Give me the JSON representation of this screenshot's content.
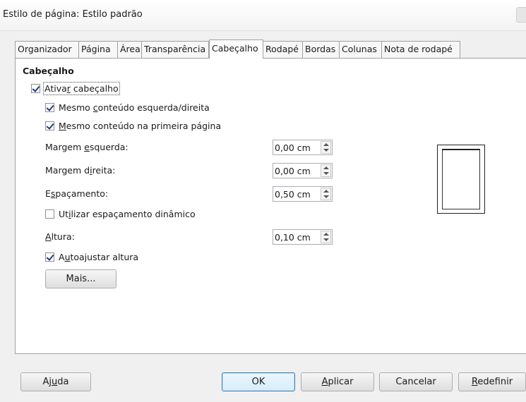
{
  "window": {
    "title": "Estilo de página: Estilo padrão"
  },
  "tabs": [
    {
      "label": "Organizador",
      "active": false
    },
    {
      "label": "Página",
      "active": false
    },
    {
      "label": "Área",
      "active": false
    },
    {
      "label": "Transparência",
      "active": false
    },
    {
      "label": "Cabeçalho",
      "active": true
    },
    {
      "label": "Rodapé",
      "active": false
    },
    {
      "label": "Bordas",
      "active": false
    },
    {
      "label": "Colunas",
      "active": false
    },
    {
      "label": "Nota de rodapé",
      "active": false
    }
  ],
  "header": {
    "section_title": "Cabeçalho",
    "enable": {
      "pre": "Ativa",
      "u": "r",
      "post": " cabeçalho",
      "checked": true
    },
    "same_lr": {
      "pre": "Mesmo ",
      "u": "c",
      "post": "onteúdo esquerda/direita",
      "checked": true
    },
    "same_first": {
      "pre": "",
      "u": "M",
      "post": "esmo conteúdo na primeira página",
      "checked": true
    },
    "margin_left": {
      "pre": "Margem ",
      "u": "e",
      "post": "squerda:",
      "value": "0,00 cm"
    },
    "margin_right": {
      "pre": "Margem d",
      "u": "i",
      "post": "reita:",
      "value": "0,00 cm"
    },
    "spacing": {
      "pre": "E",
      "u": "s",
      "post": "paçamento:",
      "value": "0,50 cm"
    },
    "dynamic_spacing": {
      "pre": "Ut",
      "u": "i",
      "post": "lizar espaçamento dinâmico",
      "checked": false
    },
    "height": {
      "pre": "",
      "u": "A",
      "post": "ltura:",
      "value": "0,10 cm"
    },
    "autofit": {
      "pre": "A",
      "u": "u",
      "post": "toajustar altura",
      "checked": true
    },
    "more_button": "Mais..."
  },
  "buttons": {
    "help": {
      "pre": "Aj",
      "u": "u",
      "post": "da"
    },
    "ok": "OK",
    "apply": {
      "pre": "",
      "u": "A",
      "post": "plicar"
    },
    "cancel": "Cancelar",
    "reset": {
      "pre": "",
      "u": "R",
      "post": "edefinir"
    }
  }
}
